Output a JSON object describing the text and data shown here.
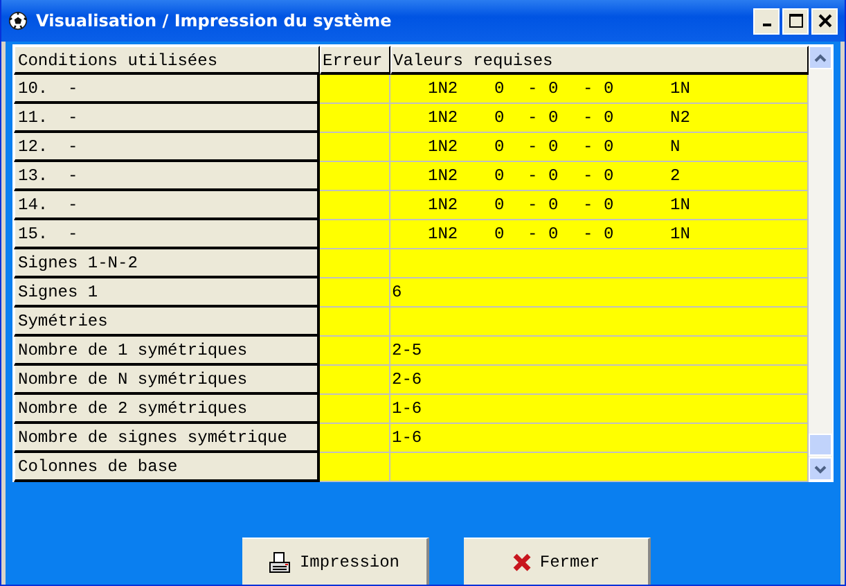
{
  "window": {
    "title": "Visualisation / Impression du système"
  },
  "table": {
    "columns": [
      "Conditions utilisées",
      "Erreur",
      "Valeurs requises"
    ],
    "rows": [
      {
        "condition": "10.  -",
        "kind": "pattern",
        "parts": [
          "1N2",
          "0",
          "-",
          "0",
          "-",
          "0",
          "1N"
        ]
      },
      {
        "condition": "11.  -",
        "kind": "pattern",
        "parts": [
          "1N2",
          "0",
          "-",
          "0",
          "-",
          "0",
          "N2"
        ]
      },
      {
        "condition": "12.  -",
        "kind": "pattern",
        "parts": [
          "1N2",
          "0",
          "-",
          "0",
          "-",
          "0",
          "N"
        ]
      },
      {
        "condition": "13.  -",
        "kind": "pattern",
        "parts": [
          "1N2",
          "0",
          "-",
          "0",
          "-",
          "0",
          "2"
        ]
      },
      {
        "condition": "14.  -",
        "kind": "pattern",
        "parts": [
          "1N2",
          "0",
          "-",
          "0",
          "-",
          "0",
          "1N"
        ]
      },
      {
        "condition": "15.  -",
        "kind": "pattern",
        "parts": [
          "1N2",
          "0",
          "-",
          "0",
          "-",
          "0",
          "1N"
        ]
      },
      {
        "condition": "Signes 1-N-2",
        "kind": "plain"
      },
      {
        "condition": "Signes 1",
        "kind": "plain",
        "value": "6"
      },
      {
        "condition": "Symétries",
        "kind": "plain"
      },
      {
        "condition": "Nombre de 1 symétriques",
        "kind": "plain",
        "value": "2-5"
      },
      {
        "condition": "Nombre de N symétriques",
        "kind": "plain",
        "value": "2-6"
      },
      {
        "condition": "Nombre de 2 symétriques",
        "kind": "plain",
        "value": "1-6"
      },
      {
        "condition": "Nombre de signes symétrique",
        "kind": "plain",
        "value": "1-6"
      },
      {
        "condition": "Colonnes de base",
        "kind": "plain"
      }
    ]
  },
  "buttons": [
    {
      "label": "Impression",
      "kind": "print"
    },
    {
      "label": "Fermer",
      "kind": "close"
    }
  ]
}
